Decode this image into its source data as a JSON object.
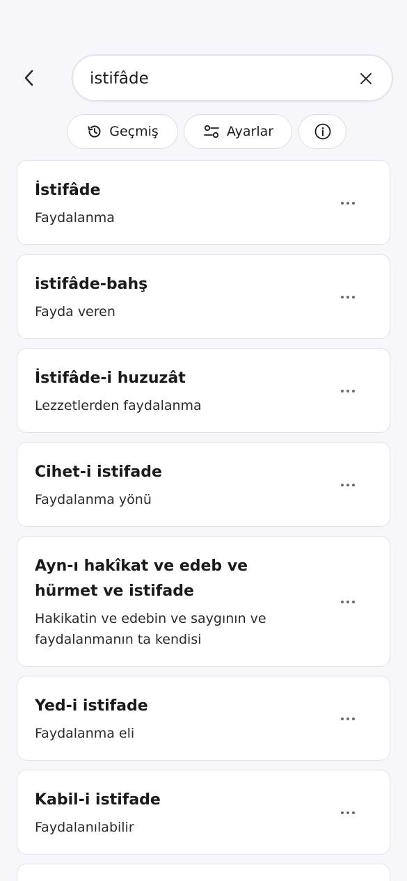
{
  "header": {
    "back_icon": "chevron-left-icon",
    "search": {
      "value": "istifâde",
      "placeholder": "",
      "clear_icon": "close-icon"
    }
  },
  "filters": [
    {
      "label": "Geçmiş",
      "icon": "history-icon"
    },
    {
      "label": "Ayarlar",
      "icon": "sliders-icon"
    },
    {
      "label": "",
      "icon": "info-icon"
    }
  ],
  "results": [
    {
      "title": "İstifâde",
      "description": "Faydalanma"
    },
    {
      "title": "istifâde-bahş",
      "description": "Fayda veren"
    },
    {
      "title": "İstifâde-i huzuzât",
      "description": "Lezzetlerden faydalanma"
    },
    {
      "title": "Cihet-i istifade",
      "description": "Faydalanma yönü"
    },
    {
      "title": "Ayn-ı hakîkat ve edeb ve hürmet ve istifade",
      "description": "Hakikatin ve edebin ve saygının ve faydalanmanın ta kendisi"
    },
    {
      "title": "Yed-i istifade",
      "description": "Faydalanma eli"
    },
    {
      "title": "Kabil-i istifade",
      "description": "Faydalanılabilir"
    }
  ],
  "colors": {
    "background": "#f7f6fb",
    "card": "#ffffff",
    "border": "#e2e1e7",
    "text": "#1c1c1f"
  }
}
